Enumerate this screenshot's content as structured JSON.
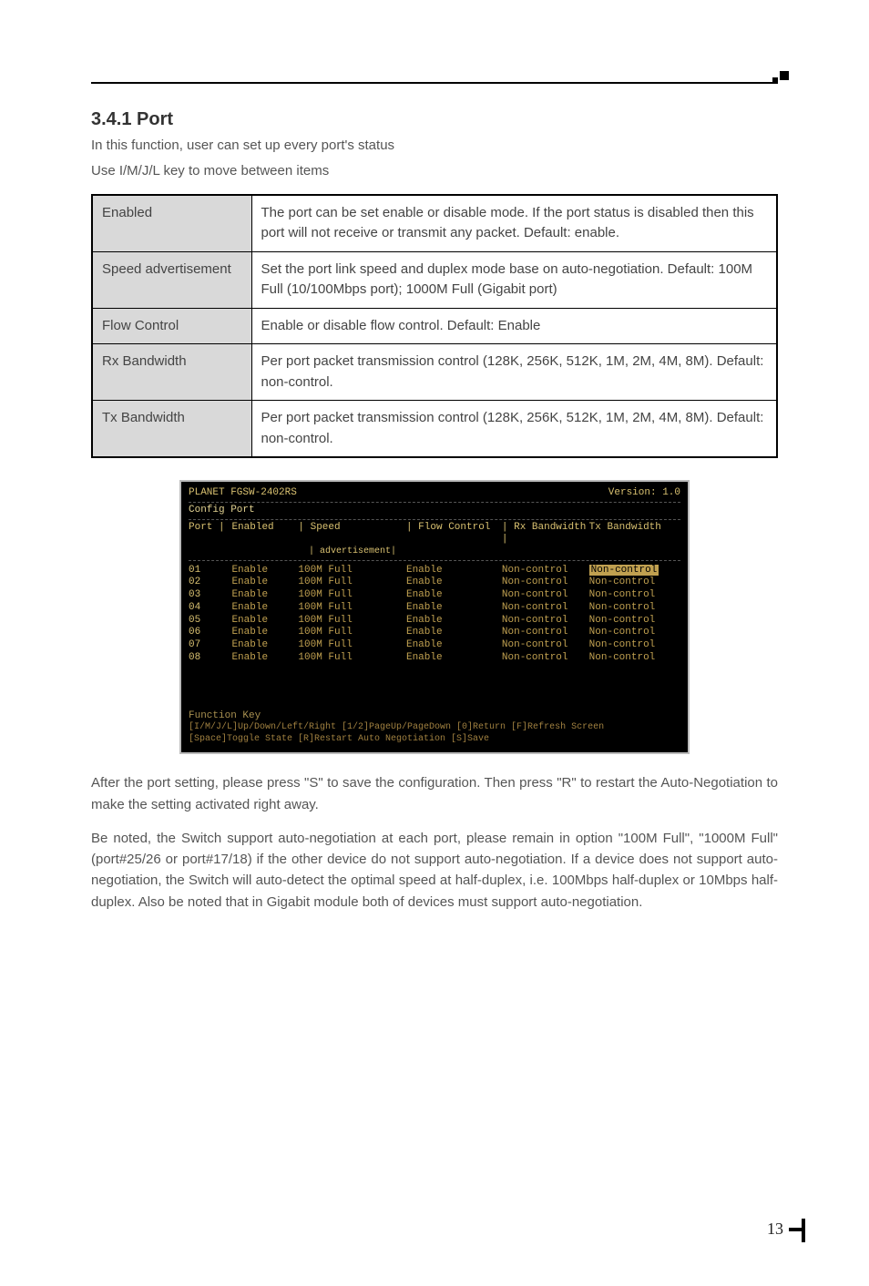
{
  "section": {
    "title": "3.4.1 Port",
    "intro1": "In this function, user can set up every port's status",
    "intro2": "Use I/M/J/L key to move between items"
  },
  "params": [
    {
      "label": "Enabled",
      "desc": "The port can be set enable or disable mode. If the port status is disabled then this port will not receive or transmit any packet. Default: enable."
    },
    {
      "label": "Speed advertisement",
      "desc": "Set the port link speed and duplex mode base on auto-negotiation. Default: 100M Full (10/100Mbps port); 1000M Full (Gigabit port)"
    },
    {
      "label": "Flow Control",
      "desc": "Enable or disable flow control. Default: Enable"
    },
    {
      "label": "Rx Bandwidth",
      "desc": "Per port packet transmission control (128K, 256K, 512K, 1M, 2M, 4M, 8M). Default: non-control."
    },
    {
      "label": "Tx Bandwidth",
      "desc": "Per port packet transmission control (128K, 256K, 512K, 1M, 2M, 4M, 8M). Default: non-control."
    }
  ],
  "terminal": {
    "device": "PLANET FGSW-2402RS",
    "version": "Version: 1.0",
    "breadcrumb": "Config Port",
    "headers": {
      "port": "Port |",
      "enabled": "Enabled",
      "speed": "| Speed",
      "speed_sub": "| advertisement|",
      "flow": "| Flow Control",
      "rx": "| Rx Bandwidth |",
      "tx": "Tx Bandwidth"
    },
    "rows": [
      {
        "port": "01",
        "enabled": "Enable",
        "speed": "100M Full",
        "flow": "Enable",
        "rx": "Non-control",
        "tx": "Non-control"
      },
      {
        "port": "02",
        "enabled": "Enable",
        "speed": "100M Full",
        "flow": "Enable",
        "rx": "Non-control",
        "tx": "Non-control"
      },
      {
        "port": "03",
        "enabled": "Enable",
        "speed": "100M Full",
        "flow": "Enable",
        "rx": "Non-control",
        "tx": "Non-control"
      },
      {
        "port": "04",
        "enabled": "Enable",
        "speed": "100M Full",
        "flow": "Enable",
        "rx": "Non-control",
        "tx": "Non-control"
      },
      {
        "port": "05",
        "enabled": "Enable",
        "speed": "100M Full",
        "flow": "Enable",
        "rx": "Non-control",
        "tx": "Non-control"
      },
      {
        "port": "06",
        "enabled": "Enable",
        "speed": "100M Full",
        "flow": "Enable",
        "rx": "Non-control",
        "tx": "Non-control"
      },
      {
        "port": "07",
        "enabled": "Enable",
        "speed": "100M Full",
        "flow": "Enable",
        "rx": "Non-control",
        "tx": "Non-control"
      },
      {
        "port": "08",
        "enabled": "Enable",
        "speed": "100M Full",
        "flow": "Enable",
        "rx": "Non-control",
        "tx": "Non-control"
      }
    ],
    "fn_label": "Function Key",
    "fn_line1": "[I/M/J/L]Up/Down/Left/Right [1/2]PageUp/PageDown [0]Return [F]Refresh Screen",
    "fn_line2": "[Space]Toggle State [R]Restart Auto Negotiation [S]Save"
  },
  "after": {
    "p1": "After the port setting, please press \"S\" to save the configuration. Then press \"R\" to restart the Auto-Negotiation to make the setting activated right away.",
    "p2": " Be noted, the Switch support auto-negotiation at each port, please remain in option \"100M Full\", \"1000M Full\"  (port#25/26 or port#17/18) if the other device do not support auto-negotiation. If a device does not support auto-negotiation, the Switch will auto-detect the optimal speed at half-duplex, i.e. 100Mbps half-duplex or 10Mbps half-duplex. Also be noted that in Gigabit module both of devices must support auto-negotiation."
  },
  "page_number": "13"
}
